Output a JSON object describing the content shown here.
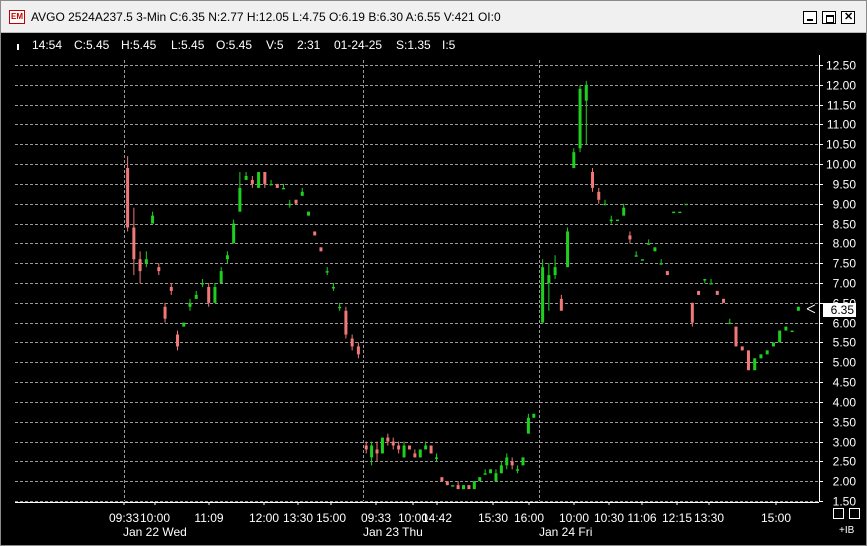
{
  "window": {
    "title": "AVGO 2524A237.5 3-Min C:6.35 N:2.77 H:12.05 L:4.75 O:6.19 B:6.30 A:6.55 V:421 OI:0",
    "icon_name": "chart-app-icon",
    "controls": [
      "minimize-icon",
      "maximize-icon",
      "close-icon"
    ]
  },
  "infobar": {
    "time": "14:54",
    "close": "C:5.45",
    "high": "H:5.45",
    "low": "L:5.45",
    "open": "O:5.45",
    "volume": "V:5",
    "count": "2:31",
    "date": "01-24-25",
    "size": "S:1.35",
    "trades": "I:5"
  },
  "colors": {
    "background": "#000000",
    "grid": "#9a9a9a",
    "up": "#1ed01e",
    "down": "#f07878",
    "text": "#ffffff"
  },
  "chart_data": {
    "type": "candlestick",
    "interval": "3-Min",
    "y_axis": {
      "ticks": [
        "12.50",
        "12.00",
        "11.50",
        "11.00",
        "10.50",
        "10.00",
        "9.50",
        "9.00",
        "8.50",
        "8.00",
        "7.50",
        "7.00",
        "6.50",
        "6.00",
        "5.50",
        "5.00",
        "4.50",
        "4.00",
        "3.50",
        "3.00",
        "2.50",
        "2.00",
        "1.50"
      ],
      "ylim": [
        1.5,
        12.5
      ],
      "grid": true
    },
    "x_axis": {
      "time_labels": [
        "09:33",
        "10:00",
        "11:09",
        "12:00",
        "13:30",
        "15:00",
        "09:33",
        "10:00",
        "14:42",
        "15:30",
        "16:00",
        "10:00",
        "10:30",
        "11:06",
        "12:15",
        "13:30",
        "15:00"
      ],
      "day_labels": [
        "Jan 22 Wed",
        "Jan 23 Thu",
        "Jan 24 Fri"
      ]
    },
    "last_price": "6.35",
    "corner_label": "+IB",
    "candles": [
      [
        9.9,
        10.2,
        8.3,
        8.4,
        0
      ],
      [
        8.4,
        8.9,
        7.2,
        7.6,
        0
      ],
      [
        7.6,
        7.8,
        7.0,
        7.3,
        0
      ],
      [
        7.5,
        7.8,
        7.4,
        7.6,
        0
      ],
      [
        8.5,
        8.8,
        8.5,
        8.7,
        0
      ],
      [
        7.4,
        7.5,
        7.2,
        7.3,
        0
      ],
      [
        6.4,
        6.5,
        6.0,
        6.1,
        0
      ],
      [
        6.9,
        7.0,
        6.7,
        6.8,
        0
      ],
      [
        5.7,
        5.8,
        5.3,
        5.4,
        0
      ],
      [
        5.9,
        6.0,
        5.9,
        6.0,
        0
      ],
      [
        6.4,
        6.6,
        6.3,
        6.5,
        0
      ],
      [
        6.6,
        6.8,
        6.6,
        6.7,
        0
      ],
      [
        7.0,
        7.1,
        6.9,
        7.0,
        0
      ],
      [
        6.9,
        7.0,
        6.4,
        6.5,
        0
      ],
      [
        6.5,
        7.0,
        6.5,
        6.9,
        0
      ],
      [
        7.0,
        7.4,
        7.0,
        7.3,
        0
      ],
      [
        7.6,
        7.8,
        7.5,
        7.7,
        0
      ],
      [
        8.0,
        8.6,
        8.0,
        8.5,
        0
      ],
      [
        8.8,
        9.8,
        8.8,
        9.4,
        0
      ],
      [
        9.6,
        9.8,
        9.6,
        9.7,
        0
      ],
      [
        9.6,
        9.7,
        9.4,
        9.5,
        0
      ],
      [
        9.4,
        9.8,
        9.4,
        9.8,
        0
      ],
      [
        9.8,
        9.8,
        9.4,
        9.5,
        0
      ],
      [
        9.5,
        9.6,
        9.5,
        9.5,
        0
      ],
      [
        9.5,
        9.5,
        9.4,
        9.4,
        0
      ],
      [
        9.4,
        9.5,
        9.4,
        9.4,
        0
      ],
      [
        9.0,
        9.1,
        8.9,
        9.0,
        0
      ],
      [
        9.1,
        9.1,
        9.0,
        9.0,
        0
      ],
      [
        9.2,
        9.4,
        9.2,
        9.3,
        0
      ],
      [
        8.7,
        8.8,
        8.7,
        8.8,
        0
      ],
      [
        8.3,
        8.3,
        8.2,
        8.2,
        0
      ],
      [
        7.9,
        7.9,
        7.8,
        7.8,
        0
      ],
      [
        7.3,
        7.4,
        7.2,
        7.3,
        0
      ],
      [
        6.9,
        7.0,
        6.8,
        6.9,
        0
      ],
      [
        6.4,
        6.5,
        6.3,
        6.4,
        0
      ],
      [
        6.3,
        6.4,
        5.6,
        5.7,
        0
      ],
      [
        5.6,
        5.7,
        5.3,
        5.4,
        0
      ],
      [
        5.4,
        5.5,
        5.1,
        5.2,
        0
      ],
      [
        2.9,
        3.0,
        2.7,
        2.8,
        1
      ],
      [
        2.6,
        3.0,
        2.4,
        2.9,
        1
      ],
      [
        2.8,
        3.0,
        2.5,
        2.7,
        1
      ],
      [
        2.7,
        3.1,
        2.7,
        3.1,
        1
      ],
      [
        3.1,
        3.2,
        2.9,
        3.0,
        1
      ],
      [
        3.0,
        3.1,
        2.8,
        2.9,
        1
      ],
      [
        2.9,
        3.0,
        2.7,
        2.8,
        1
      ],
      [
        2.6,
        3.0,
        2.6,
        2.9,
        1
      ],
      [
        2.9,
        2.9,
        2.8,
        2.8,
        1
      ],
      [
        2.7,
        2.8,
        2.6,
        2.6,
        1
      ],
      [
        2.6,
        2.8,
        2.6,
        2.8,
        1
      ],
      [
        2.8,
        3.0,
        2.8,
        2.9,
        1
      ],
      [
        2.9,
        2.9,
        2.7,
        2.7,
        1
      ],
      [
        2.6,
        2.7,
        2.5,
        2.6,
        1
      ],
      [
        2.1,
        2.1,
        2.0,
        2.0,
        1
      ],
      [
        2.0,
        2.0,
        1.9,
        1.9,
        1
      ],
      [
        1.9,
        1.9,
        1.9,
        1.9,
        1
      ],
      [
        1.9,
        2.0,
        1.8,
        1.8,
        1
      ],
      [
        1.8,
        1.9,
        1.8,
        1.9,
        1
      ],
      [
        1.9,
        1.9,
        1.8,
        1.8,
        1
      ],
      [
        1.8,
        2.0,
        1.8,
        2.0,
        1
      ],
      [
        2.0,
        2.1,
        2.0,
        2.1,
        1
      ],
      [
        2.2,
        2.3,
        2.2,
        2.2,
        1
      ],
      [
        2.2,
        2.3,
        2.2,
        2.3,
        1
      ],
      [
        2.0,
        2.3,
        2.0,
        2.2,
        1
      ],
      [
        2.2,
        2.5,
        2.2,
        2.4,
        1
      ],
      [
        2.4,
        2.7,
        2.3,
        2.6,
        1
      ],
      [
        2.5,
        2.6,
        2.3,
        2.4,
        1
      ],
      [
        2.3,
        2.4,
        2.2,
        2.3,
        1
      ],
      [
        2.4,
        2.6,
        2.4,
        2.6,
        1
      ],
      [
        3.2,
        3.7,
        3.2,
        3.6,
        1
      ],
      [
        3.6,
        3.7,
        3.6,
        3.7,
        1
      ],
      [
        6.0,
        7.6,
        6.0,
        7.4,
        2
      ],
      [
        7.0,
        7.5,
        6.3,
        7.2,
        2
      ],
      [
        7.2,
        7.7,
        7.1,
        7.4,
        2
      ],
      [
        6.6,
        6.7,
        6.3,
        6.3,
        2
      ],
      [
        7.4,
        8.4,
        7.4,
        8.3,
        2
      ],
      [
        9.9,
        10.4,
        9.9,
        10.3,
        2
      ],
      [
        10.4,
        12.0,
        10.3,
        11.9,
        2
      ],
      [
        11.6,
        12.1,
        10.5,
        12.0,
        2
      ],
      [
        9.8,
        9.9,
        9.3,
        9.4,
        2
      ],
      [
        9.3,
        9.4,
        9.0,
        9.1,
        2
      ],
      [
        9.0,
        9.1,
        9.0,
        9.0,
        2
      ],
      [
        8.6,
        8.7,
        8.5,
        8.6,
        2
      ],
      [
        8.6,
        8.6,
        8.6,
        8.6,
        2
      ],
      [
        8.7,
        9.0,
        8.7,
        8.9,
        2
      ],
      [
        8.2,
        8.3,
        8.0,
        8.1,
        2
      ],
      [
        7.7,
        7.8,
        7.7,
        7.7,
        2
      ],
      [
        7.6,
        7.6,
        7.6,
        7.6,
        2
      ],
      [
        8.0,
        8.1,
        8.0,
        8.0,
        2
      ],
      [
        7.8,
        7.9,
        7.8,
        7.9,
        2
      ],
      [
        7.5,
        7.6,
        7.5,
        7.5,
        2
      ],
      [
        7.3,
        7.3,
        7.2,
        7.2,
        2
      ],
      [
        8.8,
        8.8,
        8.8,
        8.8,
        2
      ],
      [
        8.8,
        8.8,
        8.8,
        8.8,
        2
      ],
      [
        9.0,
        9.0,
        9.0,
        9.0,
        2
      ],
      [
        6.5,
        6.5,
        5.9,
        6.0,
        2
      ],
      [
        6.8,
        6.8,
        6.7,
        6.7,
        2
      ],
      [
        7.1,
        7.1,
        7.0,
        7.1,
        2
      ],
      [
        7.0,
        7.1,
        7.0,
        7.0,
        2
      ],
      [
        6.8,
        6.8,
        6.7,
        6.7,
        2
      ],
      [
        6.6,
        6.6,
        6.5,
        6.5,
        2
      ],
      [
        6.0,
        6.1,
        6.0,
        6.0,
        2
      ],
      [
        5.9,
        5.9,
        5.4,
        5.4,
        2
      ],
      [
        5.4,
        5.4,
        5.3,
        5.3,
        2
      ],
      [
        5.3,
        5.3,
        4.8,
        4.8,
        2
      ],
      [
        4.8,
        5.1,
        4.8,
        5.1,
        2
      ],
      [
        5.1,
        5.2,
        5.1,
        5.2,
        2
      ],
      [
        5.2,
        5.3,
        5.2,
        5.3,
        2
      ],
      [
        5.4,
        5.5,
        5.4,
        5.5,
        2
      ],
      [
        5.5,
        5.8,
        5.5,
        5.8,
        2
      ],
      [
        5.8,
        5.9,
        5.8,
        5.9,
        2
      ],
      [
        5.8,
        5.8,
        5.8,
        5.8,
        2
      ],
      [
        6.3,
        6.4,
        6.3,
        6.4,
        2
      ]
    ]
  }
}
